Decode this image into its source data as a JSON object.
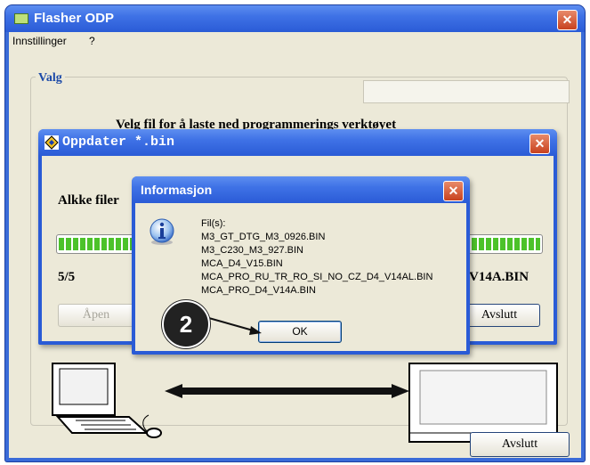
{
  "main_window": {
    "title": "Flasher ODP",
    "menu": [
      "Innstillinger",
      "?"
    ],
    "group_label": "Valg",
    "instruction": "Velg fil for å laste ned programmerings verktøyet",
    "exit_label": "Avslutt"
  },
  "update_dialog": {
    "title": "Oppdater *.bin",
    "heading": "Alkke filer",
    "count": "5/5",
    "current_file": "V14A.BIN",
    "open_label": "Åpen",
    "exit_label": "Avslutt",
    "progress": 1.0
  },
  "info_dialog": {
    "title": "Informasjon",
    "lines": [
      "Fil(s):",
      "M3_GT_DTG_M3_0926.BIN",
      "M3_C230_M3_927.BIN",
      "MCA_D4_V15.BIN",
      "MCA_PRO_RU_TR_RO_SI_NO_CZ_D4_V14AL.BIN",
      "MCA_PRO_D4_V14A.BIN"
    ],
    "ok_label": "OK"
  },
  "callout": {
    "number": "2"
  },
  "colors": {
    "title_bar": "#3f72e6",
    "close_button": "#c8411e",
    "window_bg": "#ece9d8",
    "progress": "#4cc22a"
  }
}
